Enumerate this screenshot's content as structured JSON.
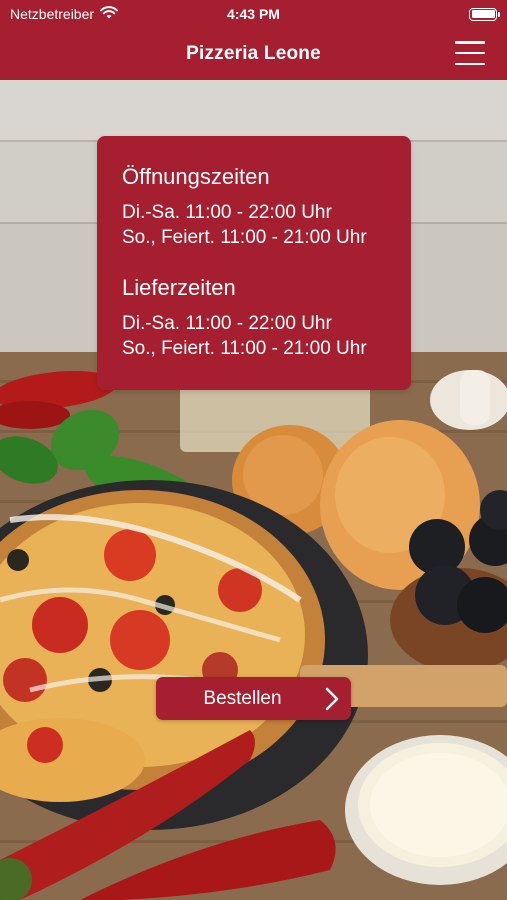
{
  "status_bar": {
    "carrier": "Netzbetreiber",
    "time": "4:43 PM",
    "icons": [
      "wifi-icon",
      "battery-icon"
    ]
  },
  "nav": {
    "title": "Pizzeria Leone",
    "menu_icon": "hamburger-menu-icon"
  },
  "hours_card": {
    "opening_title": "Öffnungszeiten",
    "opening_lines": [
      "Di.-Sa. 11:00 - 22:00 Uhr",
      "So., Feiert. 11:00 - 21:00 Uhr"
    ],
    "delivery_title": "Lieferzeiten",
    "delivery_lines": [
      "Di.-Sa. 11:00 - 22:00 Uhr",
      "So., Feiert. 11:00 - 21:00 Uhr"
    ]
  },
  "order_button": {
    "label": "Bestellen",
    "icon": "chevron-right-icon"
  },
  "colors": {
    "brand": "#a51f30",
    "text_on_brand": "#ffffff"
  }
}
